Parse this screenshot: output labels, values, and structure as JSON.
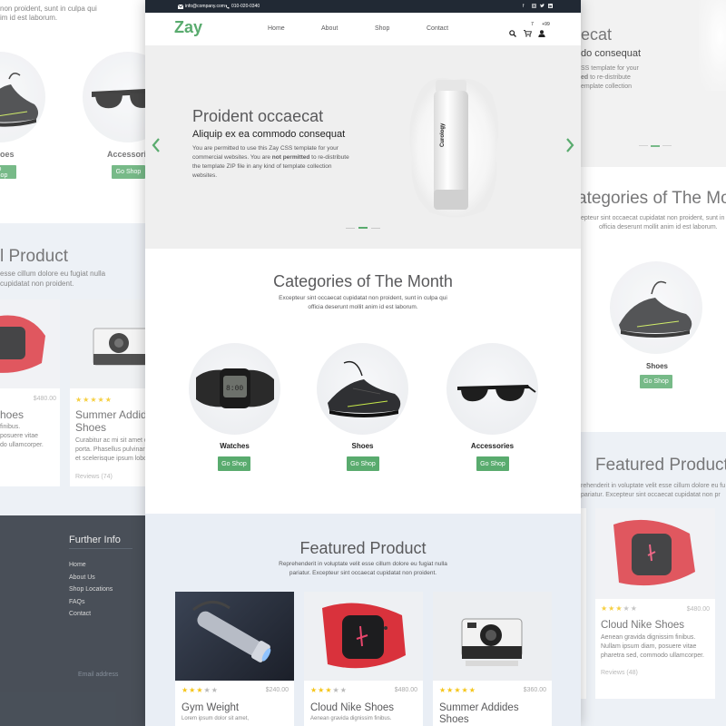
{
  "colors": {
    "brand": "#59ab6e",
    "topbar": "#212934",
    "footer": "#212934",
    "featured_bg": "#e9eef5",
    "hero_bg": "#efefef",
    "star": "#f5c518"
  },
  "topbar": {
    "email": "info@company.com",
    "phone": "010-020-0340"
  },
  "nav": {
    "logo": "Zay",
    "links": [
      "Home",
      "About",
      "Shop",
      "Contact"
    ],
    "cart_count": "7",
    "user_count": "+99"
  },
  "hero": {
    "title": "Proident occaecat",
    "subtitle": "Aliquip ex ea commodo consequat",
    "text_pre": "You are permitted to use this Zay CSS template for your commercial websites. You are ",
    "text_bold1": "not permitted",
    "text_post": " to re-distribute the template ZIP file in any kind of template collection websites.",
    "product_label": "Curology"
  },
  "categories": {
    "title": "Categories of The Month",
    "desc_line1": "Excepteur sint occaecat cupidatat non proident, sunt in culpa qui",
    "desc_line2": "officia deserunt mollit anim id est laborum.",
    "items": [
      {
        "name": "Watches",
        "button": "Go Shop"
      },
      {
        "name": "Shoes",
        "button": "Go Shop"
      },
      {
        "name": "Accessories",
        "button": "Go Shop"
      }
    ]
  },
  "featured": {
    "title": "Featured Product",
    "desc_line1": "Reprehenderit in voluptate velit esse cillum dolore eu fugiat nulla",
    "desc_line2": "pariatur. Excepteur sint occaecat cupidatat non proident.",
    "products": [
      {
        "name": "Gym Weight",
        "price": "$240.00",
        "rating": 3,
        "text": "Lorem ipsum dolor sit amet,"
      },
      {
        "name": "Cloud Nike Shoes",
        "price": "$480.00",
        "rating": 3,
        "text": "Aenean gravida dignissim finibus."
      },
      {
        "name": "Summer Addides",
        "name2": "Shoes",
        "price": "$360.00",
        "rating": 5,
        "text": ""
      }
    ]
  },
  "left_view": {
    "top_text1": "non proident, sunt in culpa qui",
    "top_text2": "im id est laborum.",
    "cat_shoes": "oes",
    "cat_accessories": "Accessories",
    "go_shop": "Go Shop",
    "featured_title": "l Product",
    "featured_desc1": "esse cillum dolore eu fugiat nulla",
    "featured_desc2": "cupidatat non proident.",
    "card1_price": "$480.00",
    "card1_title": "hoes",
    "card1_text1": "finibus.",
    "card1_text2": "posuere vitae",
    "card1_text3": "do ullamcorper.",
    "card2_title1": "Summer Addide",
    "card2_title2": "Shoes",
    "card2_text1": "Curabitur ac mi sit amet d",
    "card2_text2": "porta. Phasellus pulvinar s",
    "card2_text3": "et scelerisque ipsum lobor",
    "card2_reviews": "Reviews (74)",
    "footer_title": "Further Info",
    "footer_links": [
      "Home",
      "About Us",
      "Shop Locations",
      "FAQs",
      "Contact"
    ],
    "email_placeholder": "Email address"
  },
  "right_view": {
    "hero_frag1": "ecat",
    "hero_frag2": "do consequat",
    "hero_frag3": "SS template for your",
    "hero_frag4_bold": "ed",
    "hero_frag4": " to re-distribute",
    "hero_frag5": "emplate collection",
    "cat_title": "ategories of The Mo",
    "cat_desc1": "epteur sint occaecat cupidatat non proident, sunt in",
    "cat_desc2": "officia deserunt mollit anim id est laborum.",
    "cat_shoes": "Shoes",
    "go_shop": "Go Shop",
    "featured_title": "Featured Product",
    "featured_desc1": "rehenderit in voluptate velit esse cillum dolore eu fu",
    "featured_desc2": "pariatur. Excepteur sint occaecat cupidatat non pr",
    "card_price": "$480.00",
    "card_title": "Cloud Nike Shoes",
    "card_text1": "Aenean gravida dignissim finibus.",
    "card_text2": "Nullam ipsum diam, posuere vitae",
    "card_text3": "pharetra sed, commodo ullamcorper.",
    "card_reviews": "Reviews (48)"
  }
}
